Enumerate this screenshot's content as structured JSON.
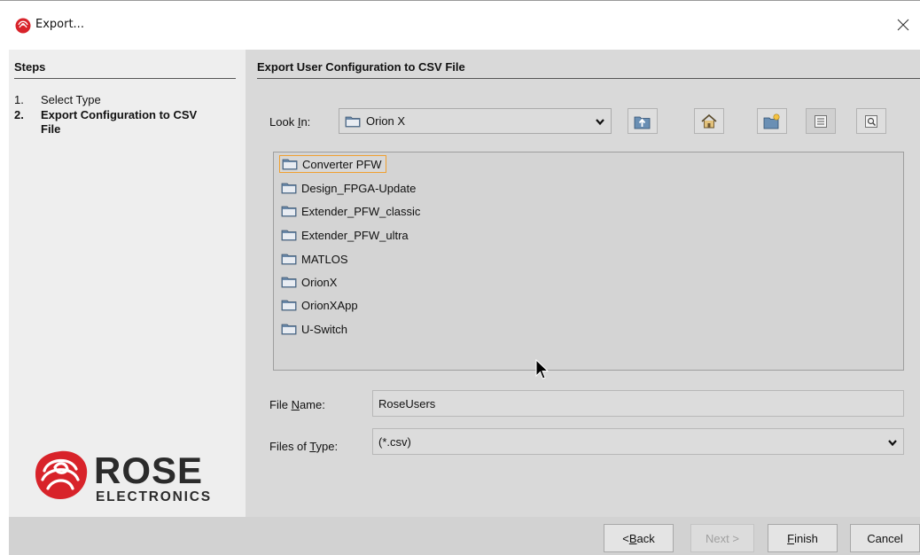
{
  "window": {
    "title": "Export..."
  },
  "steps": {
    "title": "Steps",
    "items": [
      {
        "num": "1.",
        "label": "Select Type"
      },
      {
        "num": "2.",
        "label": "Export  Configuration to CSV File"
      }
    ]
  },
  "logo": {
    "brand": "ROSE",
    "sub": "ELECTRONICS"
  },
  "main": {
    "heading": "Export User Configuration to CSV File",
    "look_in": {
      "label_pre": "Look ",
      "label_mn": "I",
      "label_post": "n:",
      "value": "Orion X"
    },
    "files": [
      "Converter PFW",
      "Design_FPGA-Update",
      "Extender_PFW_classic",
      "Extender_PFW_ultra",
      "MATLOS",
      "OrionX",
      "OrionXApp",
      "U-Switch"
    ],
    "file_name": {
      "label_pre": "File ",
      "label_mn": "N",
      "label_post": "ame:",
      "value": "RoseUsers"
    },
    "file_type": {
      "label_pre": "Files of ",
      "label_mn": "T",
      "label_post": "ype:",
      "value": "(*.csv)"
    }
  },
  "buttons": {
    "back_pre": "< ",
    "back_mn": "B",
    "back_post": "ack",
    "next": "Next >",
    "finish_mn": "F",
    "finish_post": "inish",
    "cancel": "Cancel"
  },
  "colors": {
    "panel": "#d9d9d9",
    "steps_bg": "#eeeeee",
    "selection": "#f0a030",
    "logo_red": "#d8232a",
    "logo_text": "#2b2b2b"
  },
  "icons": [
    "rose-app-icon",
    "close-icon",
    "folder-icon",
    "up-folder-icon",
    "home-icon",
    "new-folder-icon",
    "list-view-icon",
    "details-view-icon",
    "chevron-down-icon"
  ]
}
